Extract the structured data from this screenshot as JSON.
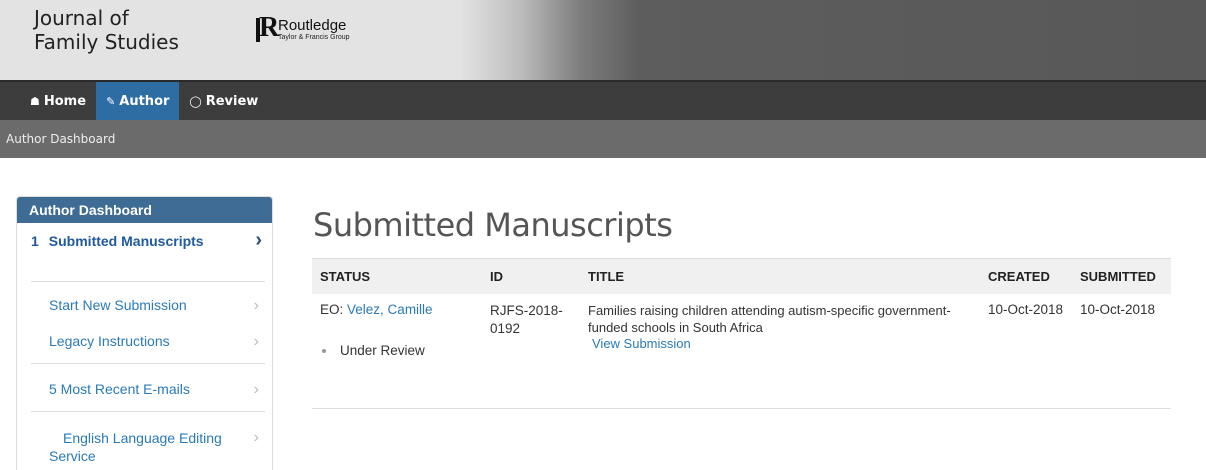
{
  "header": {
    "journal_line1": "Journal of",
    "journal_line2": "Family Studies",
    "publisher_name": "Routledge",
    "publisher_sub": "Taylor & Francis Group"
  },
  "nav": {
    "home": "Home",
    "author": "Author",
    "review": "Review"
  },
  "breadcrumb": "Author Dashboard",
  "sidebar": {
    "title": "Author Dashboard",
    "active_num": "1",
    "active_label": "Submitted Manuscripts",
    "items": [
      {
        "label": "Start New Submission"
      },
      {
        "label": "Legacy Instructions"
      },
      {
        "label": "5 Most Recent E-mails"
      },
      {
        "label": "English Language Editing Service"
      }
    ]
  },
  "main": {
    "title": "Submitted Manuscripts",
    "columns": [
      "STATUS",
      "ID",
      "TITLE",
      "CREATED",
      "SUBMITTED"
    ],
    "row": {
      "eo_label": "EO:",
      "eo_name": "Velez, Camille",
      "status": "Under Review",
      "id": "RJFS-2018-0192",
      "title": "Families raising children attending autism-specific government-funded schools in South Africa",
      "view_link": "View Submission",
      "created": "10-Oct-2018",
      "submitted": "10-Oct-2018"
    }
  },
  "colors": {
    "nav_active": "#2e6da4",
    "sidebar_head": "#3e6c94",
    "link": "#2a7ab8"
  }
}
